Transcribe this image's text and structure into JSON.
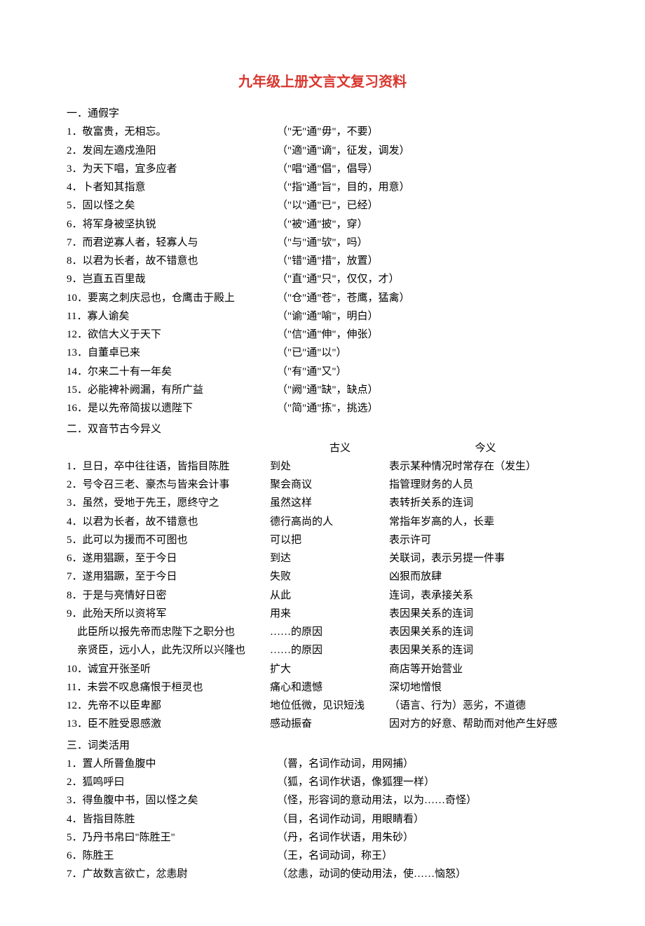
{
  "title": "九年级上册文言文复习资料",
  "section1": {
    "head": "一．通假字",
    "items": [
      {
        "l": "1．敬富贵，无相忘。",
        "r": "（\"无\"通\"毋\"，不要）"
      },
      {
        "l": "2．发闾左適戍渔阳",
        "r": "（\"適\"通\"谪\"，征发，调发）"
      },
      {
        "l": "3．为天下唱，宜多应者",
        "r": "（\"唱\"通\"倡\"，倡导）"
      },
      {
        "l": "4．卜者知其指意",
        "r": "（\"指\"通\"旨\"，目的，用意）"
      },
      {
        "l": "5．固以怪之矣",
        "r": "（\"以\"通\"已\"，已经）"
      },
      {
        "l": "6．将军身被坚执锐",
        "r": "（\"被\"通\"披\"，穿）"
      },
      {
        "l": "7．而君逆寡人者，轻寡人与",
        "r": "（\"与\"通\"欤\"，吗）"
      },
      {
        "l": "8．以君为长者，故不错意也",
        "r": "（\"错\"通\"措\"，放置）"
      },
      {
        "l": "9．岂直五百里哉",
        "r": "（\"直\"通\"只\"，仅仅，才）"
      },
      {
        "l": "10．要离之刺庆忌也，仓鹰击于殿上",
        "r": "（\"仓\"通\"苍\"，苍鹰，猛禽）"
      },
      {
        "l": "11．寡人谕矣",
        "r": "（\"谕\"通\"喻\"，明白）"
      },
      {
        "l": "12．欲信大义于天下",
        "r": "（\"信\"通\"伸\"，伸张）"
      },
      {
        "l": "13．自董卓已来",
        "r": "（\"已\"通\"以\"）"
      },
      {
        "l": "14．尔来二十有一年矣",
        "r": "（\"有\"通\"又\"）"
      },
      {
        "l": "15．必能裨补阙漏，有所广益",
        "r": "（\"阙\"通\"缺\"，缺点）"
      },
      {
        "l": "16．是以先帝简拔以遗陛下",
        "r": "（\"简\"通\"拣\"，挑选）"
      }
    ]
  },
  "section2": {
    "head": "二．双音节古今异义",
    "header": {
      "gu": "古义",
      "jin": "今义"
    },
    "items": [
      {
        "l": "1．旦日，卒中往往语，皆指目陈胜",
        "g": "到处",
        "j": "表示某种情况时常存在（发生）"
      },
      {
        "l": "2．号令召三老、豪杰与皆来会计事",
        "g": "聚会商议",
        "j": "指管理财务的人员"
      },
      {
        "l": "3．虽然，受地于先王，愿终守之",
        "g": "虽然这样",
        "j": "表转折关系的连词"
      },
      {
        "l": "4．以君为长者，故不错意也",
        "g": "德行高尚的人",
        "j": "常指年岁高的人，长辈"
      },
      {
        "l": "5．此可以为援而不可图也",
        "g": "可以把",
        "j": "表示许可"
      },
      {
        "l": "6．遂用猖蹶，至于今日",
        "g": "到达",
        "j": "关联词，表示另提一件事"
      },
      {
        "l": "7．遂用猖蹶，至于今日",
        "g": "失败",
        "j": "凶狠而放肆"
      },
      {
        "l": "8．于是与亮情好日密",
        "g": "从此",
        "j": "连词，表承接关系"
      },
      {
        "l": "9．此殆天所以资将军",
        "g": "用来",
        "j": "表因果关系的连词"
      },
      {
        "l": "    此臣所以报先帝而忠陛下之职分也",
        "g": "……的原因",
        "j": "表因果关系的连词"
      },
      {
        "l": "    亲贤臣，远小人，此先汉所以兴隆也",
        "g": "……的原因",
        "j": "表因果关系的连词"
      },
      {
        "l": "10．诚宜开张圣听",
        "g": "扩大",
        "j": "商店等开始营业"
      },
      {
        "l": "11．未尝不叹息痛恨于桓灵也",
        "g": "痛心和遗憾",
        "j": "深切地憎恨"
      },
      {
        "l": "12．先帝不以臣卑鄙",
        "g": "地位低微，见识短浅",
        "j": "（语言、行为）恶劣，不道德"
      },
      {
        "l": "13．臣不胜受恩感激",
        "g": "感动振奋",
        "j": "因对方的好意、帮助而对他产生好感"
      }
    ]
  },
  "section3": {
    "head": "三．词类活用",
    "items": [
      {
        "l": "1．置人所罾鱼腹中",
        "r": "（罾，名词作动词，用网捕）"
      },
      {
        "l": "2．狐鸣呼曰",
        "r": "（狐，名词作状语，像狐狸一样）"
      },
      {
        "l": "3．得鱼腹中书，固以怪之矣",
        "r": "（怪，形容词的意动用法，以为……奇怪）"
      },
      {
        "l": "4．皆指目陈胜",
        "r": "（目，名词作动词，用眼睛看）"
      },
      {
        "l": "5．乃丹书帛曰\"陈胜王\"",
        "r": "（丹，名词作状语，用朱砂）"
      },
      {
        "l": "6．陈胜王",
        "r": "（王，名词动词，称王）"
      },
      {
        "l": "7．广故数言欲亡，忿恚尉",
        "r": "（忿恚，动词的使动用法，使……恼怒）"
      }
    ]
  }
}
